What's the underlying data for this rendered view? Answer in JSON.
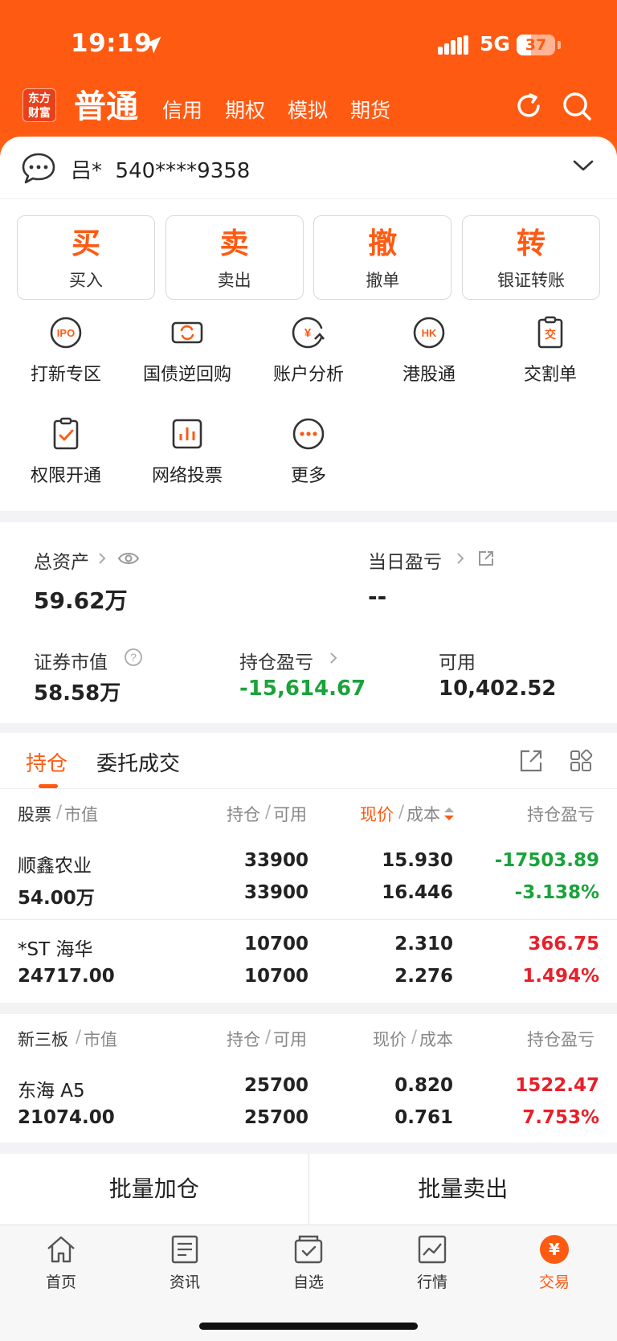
{
  "status_bar": {
    "time": "19:19",
    "network": "5G",
    "battery": "37",
    "battery_level": 0.37
  },
  "header": {
    "logo_text": "东方财富",
    "tabs": [
      "普通",
      "信用",
      "期权",
      "模拟",
      "期货"
    ]
  },
  "account": {
    "name": "吕*",
    "number": "540****9358"
  },
  "actions": [
    {
      "big": "买",
      "small": "买入"
    },
    {
      "big": "卖",
      "small": "卖出"
    },
    {
      "big": "撤",
      "small": "撤单"
    },
    {
      "big": "转",
      "small": "银证转账"
    }
  ],
  "grid": [
    {
      "label": "打新专区",
      "icon": "ipo-icon",
      "icon_text": "IPO"
    },
    {
      "label": "国债逆回购",
      "icon": "bond-repo-icon"
    },
    {
      "label": "账户分析",
      "icon": "account-analysis-icon",
      "icon_text": "¥"
    },
    {
      "label": "港股通",
      "icon": "hk-connect-icon",
      "icon_text": "HK"
    },
    {
      "label": "交割单",
      "icon": "settlement-icon",
      "icon_text": "交"
    },
    {
      "label": "权限开通",
      "icon": "permission-icon"
    },
    {
      "label": "网络投票",
      "icon": "vote-icon"
    },
    {
      "label": "更多",
      "icon": "more-icon"
    }
  ],
  "assets": {
    "total_label": "总资产",
    "total_value": "59.62万",
    "daily_pl_label": "当日盈亏",
    "daily_pl_value": "--",
    "market_value_label": "证券市值",
    "market_value": "58.58万",
    "position_pl_label": "持仓盈亏",
    "position_pl_value": "-15,614.67",
    "available_label": "可用",
    "available_value": "10,402.52"
  },
  "holdings": {
    "tabs": [
      "持仓",
      "委托成交"
    ],
    "header_stock": {
      "c1a": "股票",
      "c1b": "市值",
      "c2a": "持仓",
      "c2b": "可用",
      "c3a": "现价",
      "c3b": "成本",
      "c4": "持仓盈亏"
    },
    "stocks": [
      {
        "name": "顺鑫农业",
        "market_value": "54.00万",
        "position": "33900",
        "available": "33900",
        "price": "15.930",
        "cost": "16.446",
        "pl": "-17503.89",
        "pl_pct": "-3.138%",
        "trend": "down"
      },
      {
        "name": "*ST 海华",
        "market_value": "24717.00",
        "position": "10700",
        "available": "10700",
        "price": "2.310",
        "cost": "2.276",
        "pl": "366.75",
        "pl_pct": "1.494%",
        "trend": "up"
      }
    ],
    "header_neeq": {
      "c1a": "新三板",
      "c1b": "市值",
      "c2a": "持仓",
      "c2b": "可用",
      "c3a": "现价",
      "c3b": "成本",
      "c4": "持仓盈亏"
    },
    "neeq": [
      {
        "name": "东海 A5",
        "market_value": "21074.00",
        "position": "25700",
        "available": "25700",
        "price": "0.820",
        "cost": "0.761",
        "pl": "1522.47",
        "pl_pct": "7.753%",
        "trend": "up"
      }
    ]
  },
  "batch": {
    "add": "批量加仓",
    "sell": "批量卖出"
  },
  "tabbar": [
    {
      "label": "首页",
      "icon": "home-icon"
    },
    {
      "label": "资讯",
      "icon": "news-icon"
    },
    {
      "label": "自选",
      "icon": "watchlist-icon"
    },
    {
      "label": "行情",
      "icon": "market-icon"
    },
    {
      "label": "交易",
      "icon": "trade-icon",
      "icon_text": "¥",
      "active": true
    }
  ],
  "colors": {
    "accent": "#ff5a12",
    "loss": "#1aa33a",
    "gain": "#e8202a"
  }
}
